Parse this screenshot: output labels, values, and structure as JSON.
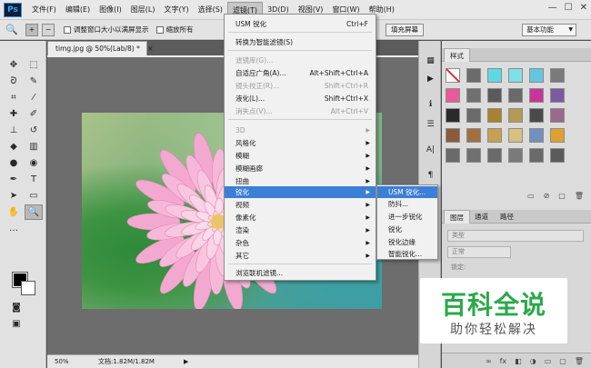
{
  "app": {
    "logo": "Ps"
  },
  "menubar": {
    "items": [
      "文件(F)",
      "编辑(E)",
      "图像(I)",
      "图层(L)",
      "文字(Y)",
      "选择(S)",
      "滤镜(T)",
      "3D(D)",
      "视图(V)",
      "窗口(W)",
      "帮助(H)"
    ],
    "active_index": 6,
    "window_controls": [
      "—",
      "☐",
      "✕"
    ]
  },
  "options_bar": {
    "zoom_in_icon": "+",
    "zoom_out_icon": "−",
    "resize_window_label": "调整窗口大小以满屏显示",
    "zoom_all_label": "缩放所有",
    "fill_screen_label": "填充屏幕",
    "workspace": "基本功能"
  },
  "document": {
    "tab_title": "timg.jpg @ 50%(Lab/8) *",
    "tab_close": "×",
    "status_zoom": "50%",
    "status_doc": "文档:1.82M/1.82M",
    "status_arrow": "▶"
  },
  "filter_menu": {
    "items": [
      {
        "label": "USM 锐化",
        "shortcut": "Ctrl+F",
        "disabled": false,
        "submenu": false
      },
      {
        "label": "转换为智能滤镜(S)",
        "shortcut": "",
        "disabled": false,
        "submenu": false
      },
      {
        "label": "滤镜库(G)...",
        "shortcut": "",
        "disabled": true,
        "submenu": false
      },
      {
        "label": "自适应广角(A)...",
        "shortcut": "Alt+Shift+Ctrl+A",
        "disabled": false,
        "submenu": false
      },
      {
        "label": "镜头校正(R)...",
        "shortcut": "Shift+Ctrl+R",
        "disabled": true,
        "submenu": false
      },
      {
        "label": "液化(L)...",
        "shortcut": "Shift+Ctrl+X",
        "disabled": false,
        "submenu": false
      },
      {
        "label": "消失点(V)...",
        "shortcut": "Alt+Ctrl+V",
        "disabled": true,
        "submenu": false
      },
      {
        "label": "3D",
        "shortcut": "",
        "disabled": true,
        "submenu": true
      },
      {
        "label": "风格化",
        "shortcut": "",
        "disabled": false,
        "submenu": true
      },
      {
        "label": "模糊",
        "shortcut": "",
        "disabled": false,
        "submenu": true
      },
      {
        "label": "模糊画廊",
        "shortcut": "",
        "disabled": false,
        "submenu": true
      },
      {
        "label": "扭曲",
        "shortcut": "",
        "disabled": false,
        "submenu": true
      },
      {
        "label": "锐化",
        "shortcut": "",
        "disabled": false,
        "submenu": true,
        "highlighted": true
      },
      {
        "label": "视频",
        "shortcut": "",
        "disabled": false,
        "submenu": true
      },
      {
        "label": "像素化",
        "shortcut": "",
        "disabled": false,
        "submenu": true
      },
      {
        "label": "渲染",
        "shortcut": "",
        "disabled": false,
        "submenu": true
      },
      {
        "label": "杂色",
        "shortcut": "",
        "disabled": false,
        "submenu": true
      },
      {
        "label": "其它",
        "shortcut": "",
        "disabled": false,
        "submenu": true
      },
      {
        "label": "浏览联机滤镜...",
        "shortcut": "",
        "disabled": false,
        "submenu": false
      }
    ]
  },
  "sharpen_submenu": {
    "items": [
      "USM 锐化...",
      "防抖...",
      "进一步锐化",
      "锐化",
      "锐化边缘",
      "智能锐化..."
    ],
    "highlighted_index": 0
  },
  "panels": {
    "styles_tab": "样式",
    "style_footer_icons": [
      "▭",
      "⊘",
      "▢",
      "🗑"
    ],
    "layers_tabs": [
      "图层",
      "通道",
      "路径"
    ],
    "layer_kind": "类型",
    "blend_mode": "正常",
    "lock_label": "锁定:",
    "layers_footer_icons": [
      "∞",
      "fx",
      "◧",
      "◑",
      "▭",
      "▢",
      "🗑"
    ]
  },
  "swatch_colors": [
    "#ffffff",
    "#6b6b6b",
    "#5fd8e6",
    "#7fe0e8",
    "#63c6e0",
    "#7a7a7a",
    "#e85a9a",
    "#707070",
    "#5a5a5a",
    "#6a6a6a",
    "#c9349a",
    "#7a5aa0",
    "#2a2a2a",
    "#6a6a6a",
    "#a8822e",
    "#b59a55",
    "#4a4a4a",
    "#9a6a8a",
    "#8a5a3a",
    "#a07040",
    "#c8a050",
    "#d8c080",
    "#7090c0",
    "#e0a030",
    "#6a6a6a",
    "#707070",
    "#6a6a6a",
    "#7a7a7a",
    "#6a6a6a",
    "#5a5a5a"
  ],
  "watermark": {
    "main": "百科全说",
    "sub": "助你轻松解决"
  },
  "colors": {
    "accent": "#3c7fd6",
    "watermark_green": "#2ca84a"
  }
}
